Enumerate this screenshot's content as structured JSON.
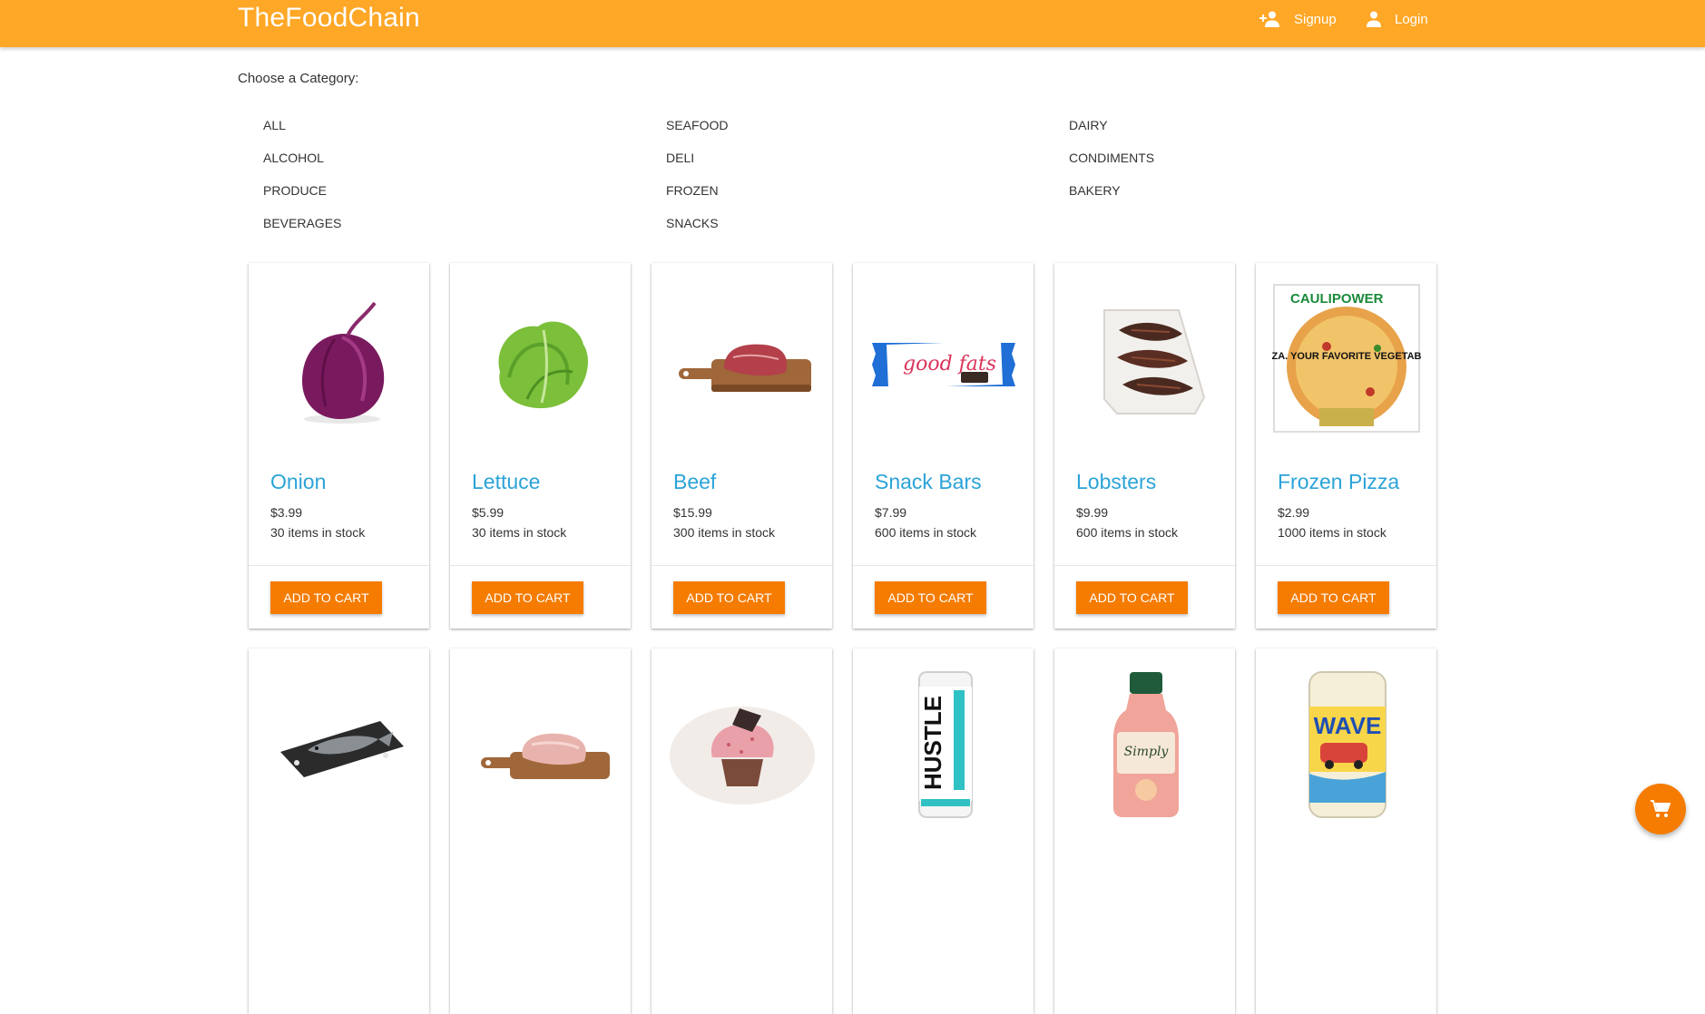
{
  "header": {
    "brand": "TheFoodChain",
    "signup_label": "Signup",
    "login_label": "Login"
  },
  "categories": {
    "heading": "Choose a Category:",
    "items": [
      "ALL",
      "SEAFOOD",
      "DAIRY",
      "ALCOHOL",
      "DELI",
      "CONDIMENTS",
      "PRODUCE",
      "FROZEN",
      "BAKERY",
      "BEVERAGES",
      "SNACKS"
    ]
  },
  "products": [
    {
      "name": "Onion",
      "price": "$3.99",
      "stock": "30 items in stock",
      "button": "ADD TO CART",
      "image": "onion"
    },
    {
      "name": "Lettuce",
      "price": "$5.99",
      "stock": "30 items in stock",
      "button": "ADD TO CART",
      "image": "lettuce"
    },
    {
      "name": "Beef",
      "price": "$15.99",
      "stock": "300 items in stock",
      "button": "ADD TO CART",
      "image": "beef"
    },
    {
      "name": "Snack Bars",
      "price": "$7.99",
      "stock": "600 items in stock",
      "button": "ADD TO CART",
      "image": "snack-bar",
      "image_text": "good fats"
    },
    {
      "name": "Lobsters",
      "price": "$9.99",
      "stock": "600 items in stock",
      "button": "ADD TO CART",
      "image": "lobsters"
    },
    {
      "name": "Frozen Pizza",
      "price": "$2.99",
      "stock": "1000 items in stock",
      "button": "ADD TO CART",
      "image": "frozen-pizza",
      "image_text": "PIZZA. YOUR FAVORITE VEGETABLE.",
      "image_brand": "CAULIPOWER"
    },
    {
      "name": "",
      "price": "",
      "stock": "",
      "button": "",
      "image": "fish"
    },
    {
      "name": "",
      "price": "",
      "stock": "",
      "button": "",
      "image": "pork"
    },
    {
      "name": "",
      "price": "",
      "stock": "",
      "button": "",
      "image": "cupcake"
    },
    {
      "name": "",
      "price": "",
      "stock": "",
      "button": "",
      "image": "energy-can",
      "image_text": "HUSTLE"
    },
    {
      "name": "",
      "price": "",
      "stock": "",
      "button": "",
      "image": "juice-bottle",
      "image_text": "Simply"
    },
    {
      "name": "",
      "price": "",
      "stock": "",
      "button": "",
      "image": "soda-can",
      "image_text": "WAVE"
    }
  ],
  "colors": {
    "appbar": "#ffa726",
    "accent": "#f57c00",
    "title": "#2ba3d8"
  },
  "icons": {
    "signup": "person-add-icon",
    "login": "person-icon",
    "cart": "shopping-cart-icon"
  }
}
